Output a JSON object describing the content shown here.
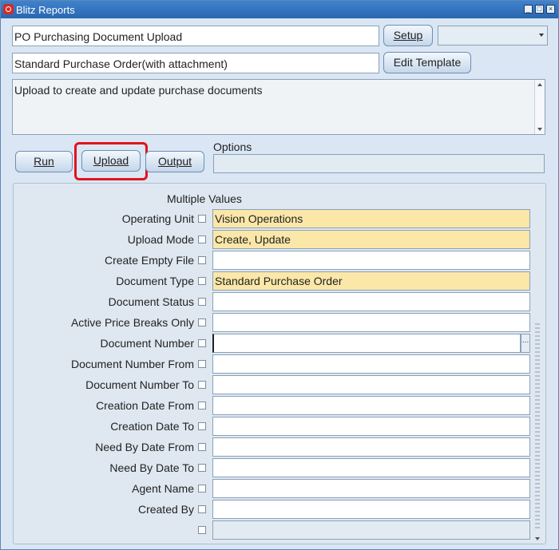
{
  "window": {
    "title": "Blitz Reports"
  },
  "header": {
    "report_name": "PO Purchasing Document Upload",
    "setup_label": "Setup",
    "template_name": "Standard Purchase Order(with attachment)",
    "edit_template_label": "Edit Template",
    "description": "Upload to create and update purchase documents"
  },
  "actions": {
    "run_label": "Run",
    "upload_label": "Upload",
    "output_label": "Output",
    "options_label": "Options",
    "options_value": ""
  },
  "parameters": {
    "multiple_values_label": "Multiple Values",
    "rows": [
      {
        "label": "Operating Unit",
        "value": "Vision Operations"
      },
      {
        "label": "Upload Mode",
        "value": "Create, Update"
      },
      {
        "label": "Create Empty File",
        "value": ""
      },
      {
        "label": "Document Type",
        "value": "Standard Purchase Order"
      },
      {
        "label": "Document Status",
        "value": ""
      },
      {
        "label": "Active Price Breaks Only",
        "value": ""
      },
      {
        "label": "Document Number",
        "value": ""
      },
      {
        "label": "Document Number From",
        "value": ""
      },
      {
        "label": "Document Number To",
        "value": ""
      },
      {
        "label": "Creation Date From",
        "value": ""
      },
      {
        "label": "Creation Date To",
        "value": ""
      },
      {
        "label": "Need By Date From",
        "value": ""
      },
      {
        "label": "Need By Date To",
        "value": ""
      },
      {
        "label": "Agent Name",
        "value": ""
      },
      {
        "label": "Created By",
        "value": ""
      },
      {
        "label": "",
        "value": ""
      }
    ]
  },
  "colors": {
    "required_field": "#fbe7a8",
    "highlight": "#e1141b",
    "titlebar": "#2a66b0"
  }
}
